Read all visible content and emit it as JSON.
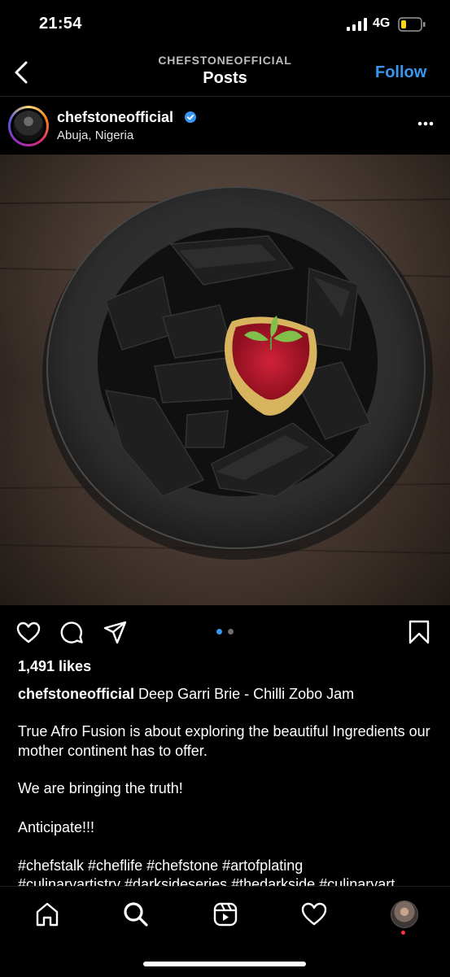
{
  "status": {
    "time": "21:54",
    "network": "4G"
  },
  "header": {
    "username": "CHEFSTONEOFFICIAL",
    "title": "Posts",
    "follow_label": "Follow"
  },
  "post": {
    "username": "chefstoneofficial",
    "location": "Abuja, Nigeria",
    "likes": "1,491 likes",
    "caption_user": "chefstoneofficial",
    "caption_title": "Deep Garri Brie - Chilli Zobo Jam",
    "paragraphs": [
      "True Afro Fusion is about exploring the beautiful Ingredients our mother continent has to offer.",
      "We are bringing the truth!",
      "Anticipate!!!",
      "#chefstalk #cheflife #chefstone #artofplating",
      "#culinaryartistry #darksideseries #thedarkside #culinaryart"
    ],
    "carousel": {
      "total": 2,
      "active": 1
    }
  },
  "colors": {
    "accent": "#3897f0",
    "notification": "#ff3040"
  },
  "icons": [
    "back-icon",
    "verified-icon",
    "more-icon",
    "heart-icon",
    "comment-icon",
    "share-icon",
    "bookmark-icon",
    "home-icon",
    "search-icon",
    "reels-icon",
    "activity-icon"
  ]
}
